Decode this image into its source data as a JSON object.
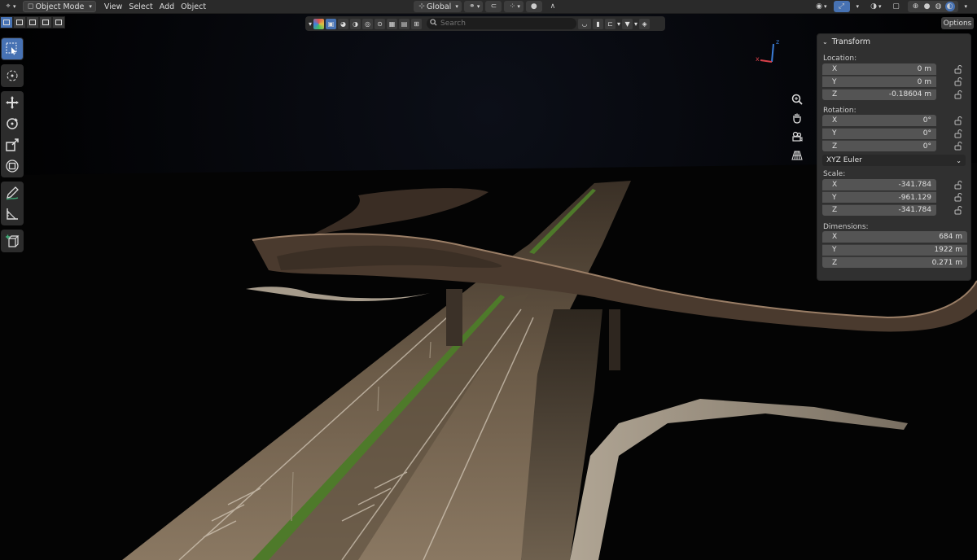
{
  "header": {
    "mode": "Object Mode",
    "menus": [
      "View",
      "Select",
      "Add",
      "Object"
    ],
    "orientation": "Global"
  },
  "viewport_header": {
    "search_placeholder": "Search"
  },
  "options_label": "Options",
  "gizmo": {
    "z": "z",
    "x": "x"
  },
  "panel": {
    "title": "Transform",
    "location": {
      "label": "Location:",
      "x": {
        "axis": "X",
        "value": "0 m"
      },
      "y": {
        "axis": "Y",
        "value": "0 m"
      },
      "z": {
        "axis": "Z",
        "value": "-0.18604 m"
      }
    },
    "rotation": {
      "label": "Rotation:",
      "x": {
        "axis": "X",
        "value": "0°"
      },
      "y": {
        "axis": "Y",
        "value": "0°"
      },
      "z": {
        "axis": "Z",
        "value": "0°"
      },
      "mode": "XYZ Euler"
    },
    "scale": {
      "label": "Scale:",
      "x": {
        "axis": "X",
        "value": "-341.784"
      },
      "y": {
        "axis": "Y",
        "value": "-961.129"
      },
      "z": {
        "axis": "Z",
        "value": "-341.784"
      }
    },
    "dimensions": {
      "label": "Dimensions:",
      "x": {
        "axis": "X",
        "value": "684 m"
      },
      "y": {
        "axis": "Y",
        "value": "1922 m"
      },
      "z": {
        "axis": "Z",
        "value": "0.271 m"
      }
    }
  },
  "colors": {
    "accent": "#4772b3",
    "header_bg": "#2a2a2a",
    "panel_bg": "#303030",
    "field_bg": "#545454"
  }
}
